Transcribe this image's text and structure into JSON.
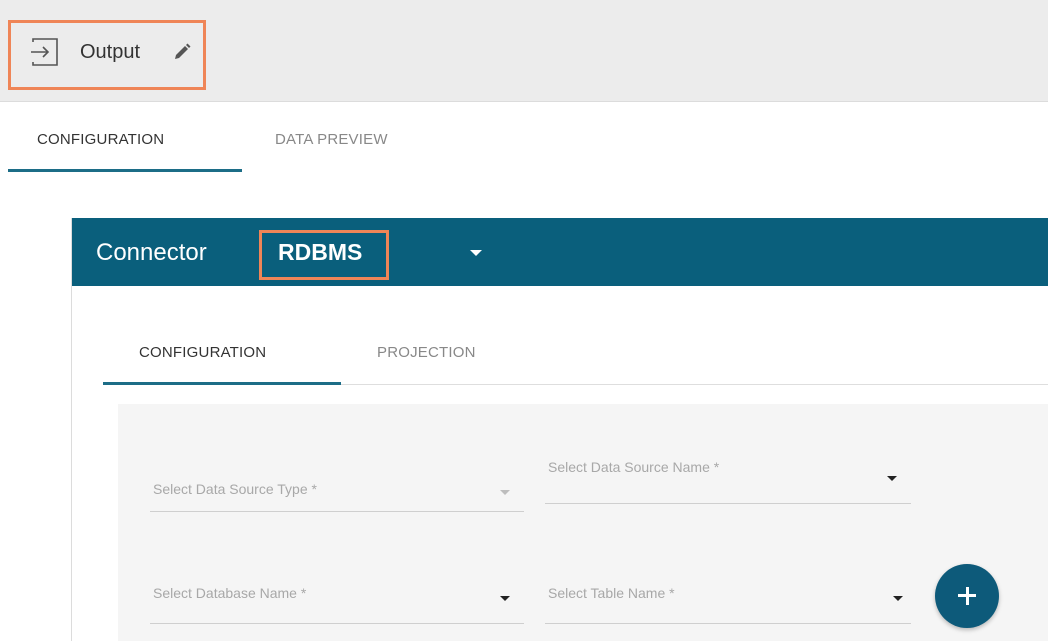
{
  "header": {
    "title": "Output",
    "icon": "output-icon",
    "edit_icon": "pencil-icon",
    "highlight_color": "#ef8557"
  },
  "tabs_top": [
    {
      "label": "CONFIGURATION",
      "active": true
    },
    {
      "label": "DATA PREVIEW",
      "active": false
    }
  ],
  "connector": {
    "label": "Connector",
    "value": "RDBMS",
    "header_color": "#0a5f7c"
  },
  "inner_tabs": [
    {
      "label": "CONFIGURATION",
      "active": true
    },
    {
      "label": "PROJECTION",
      "active": false
    }
  ],
  "form": {
    "data_source_type_placeholder": "Select Data Source Type *",
    "data_source_name_placeholder": "Select Data Source Name *",
    "database_name_placeholder": "Select Database Name *",
    "table_name_placeholder": "Select Table Name *",
    "add_icon": "plus-icon"
  },
  "colors": {
    "accent": "#1c6d87",
    "button": "#0d5a7a"
  }
}
